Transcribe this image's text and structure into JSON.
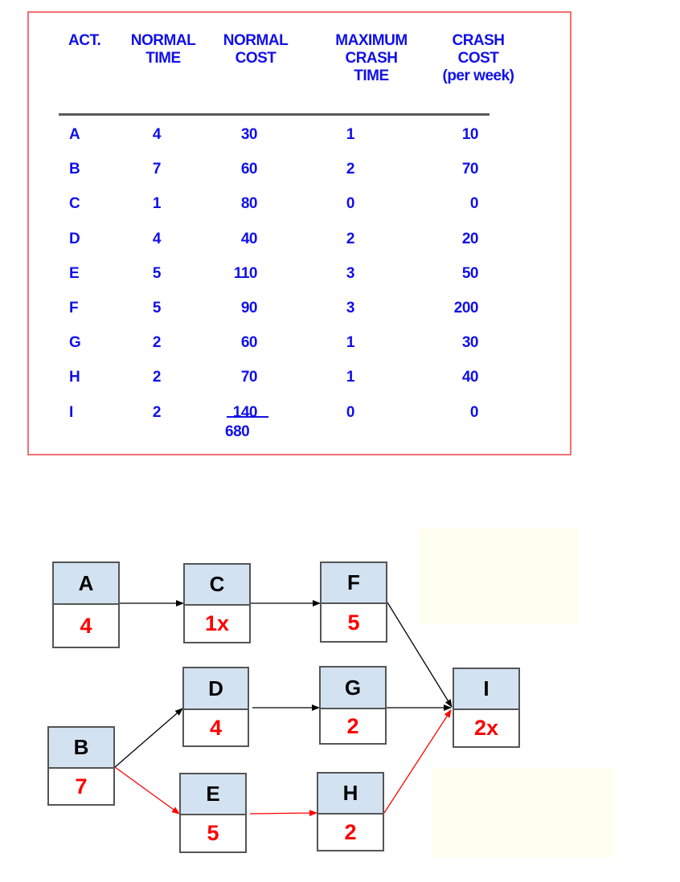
{
  "table": {
    "headers": [
      {
        "id": "act",
        "label": "ACT."
      },
      {
        "id": "normal_time",
        "label": "NORMAL\nTIME"
      },
      {
        "id": "normal_cost",
        "label": "NORMAL\nCOST"
      },
      {
        "id": "max_crash_time",
        "label": "MAXIMUM\nCRASH\nTIME"
      },
      {
        "id": "crash_cost",
        "label": "CRASH\nCOST\n(per week)"
      }
    ],
    "rows": [
      {
        "act": "A",
        "normal_time": "4",
        "normal_cost": "30",
        "max_crash_time": "1",
        "crash_cost": "10"
      },
      {
        "act": "B",
        "normal_time": "7",
        "normal_cost": "60",
        "max_crash_time": "2",
        "crash_cost": "70"
      },
      {
        "act": "C",
        "normal_time": "1",
        "normal_cost": "80",
        "max_crash_time": "0",
        "crash_cost": "0"
      },
      {
        "act": "D",
        "normal_time": "4",
        "normal_cost": "40",
        "max_crash_time": "2",
        "crash_cost": "20"
      },
      {
        "act": "E",
        "normal_time": "5",
        "normal_cost": "110",
        "max_crash_time": "3",
        "crash_cost": "50"
      },
      {
        "act": "F",
        "normal_time": "5",
        "normal_cost": "90",
        "max_crash_time": "3",
        "crash_cost": "200"
      },
      {
        "act": "G",
        "normal_time": "2",
        "normal_cost": "60",
        "max_crash_time": "1",
        "crash_cost": "30"
      },
      {
        "act": "H",
        "normal_time": "2",
        "normal_cost": "70",
        "max_crash_time": "1",
        "crash_cost": "40"
      },
      {
        "act": "I",
        "normal_time": "2",
        "normal_cost": "140",
        "max_crash_time": "0",
        "crash_cost": "0"
      }
    ],
    "normal_cost_total": "680"
  },
  "network": {
    "nodes": [
      {
        "id": "A",
        "label": "A",
        "value": "4"
      },
      {
        "id": "C",
        "label": "C",
        "value": "1x"
      },
      {
        "id": "F",
        "label": "F",
        "value": "5"
      },
      {
        "id": "B",
        "label": "B",
        "value": "7"
      },
      {
        "id": "D",
        "label": "D",
        "value": "4"
      },
      {
        "id": "G",
        "label": "G",
        "value": "2"
      },
      {
        "id": "E",
        "label": "E",
        "value": "5"
      },
      {
        "id": "H",
        "label": "H",
        "value": "2"
      },
      {
        "id": "I",
        "label": "I",
        "value": "2x"
      }
    ],
    "edges": [
      {
        "from": "A",
        "to": "C",
        "critical": false
      },
      {
        "from": "C",
        "to": "F",
        "critical": false
      },
      {
        "from": "F",
        "to": "I",
        "critical": false
      },
      {
        "from": "B",
        "to": "D",
        "critical": false
      },
      {
        "from": "D",
        "to": "G",
        "critical": false
      },
      {
        "from": "G",
        "to": "I",
        "critical": false
      },
      {
        "from": "B",
        "to": "E",
        "critical": true
      },
      {
        "from": "E",
        "to": "H",
        "critical": true
      },
      {
        "from": "H",
        "to": "I",
        "critical": true
      }
    ],
    "colors": {
      "critical_path": "#ff0000",
      "normal_path": "#000000",
      "node_header": "#d3e2f1",
      "duration_text": "#ff0000",
      "table_text": "#1010e8",
      "table_border": "#f26f72",
      "note_fill": "#fffff0"
    }
  }
}
